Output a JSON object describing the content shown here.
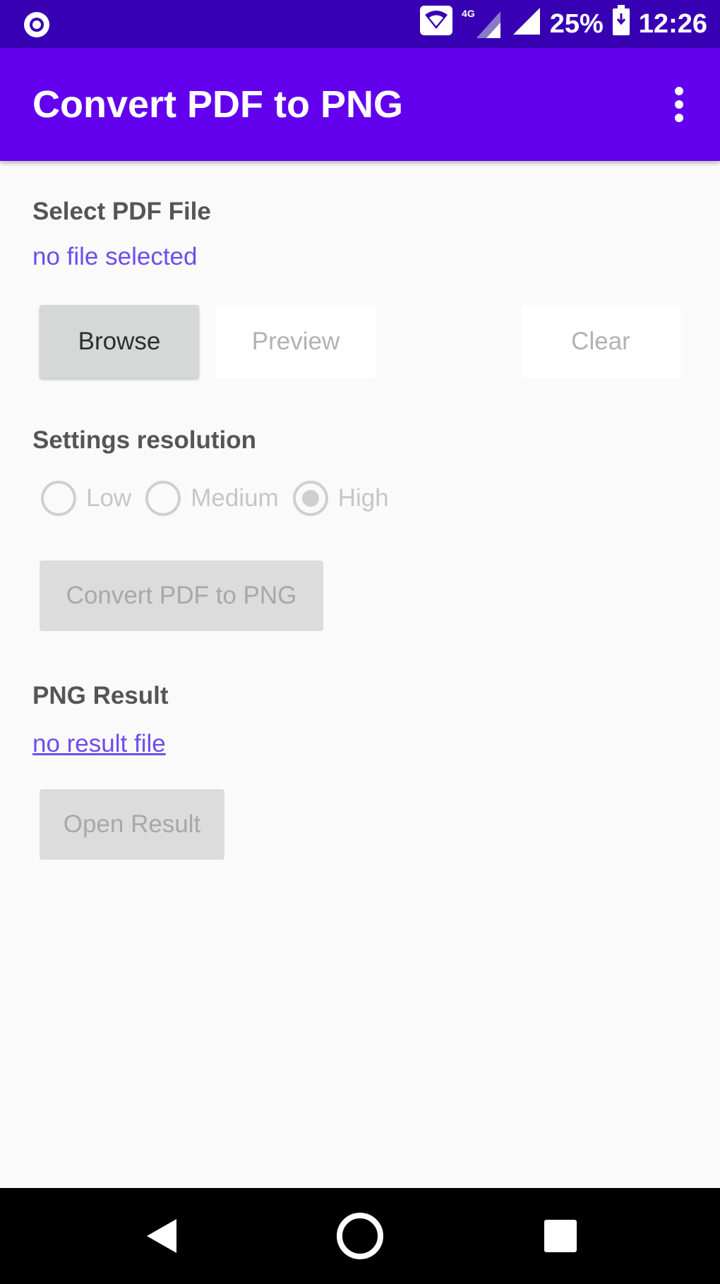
{
  "status_bar": {
    "battery": "25%",
    "time": "12:26",
    "network": "4G"
  },
  "app_bar": {
    "title": "Convert PDF to PNG",
    "menu_icon": "more-vert-icon"
  },
  "select_section": {
    "label": "Select PDF File",
    "file_status": "no file selected",
    "buttons": {
      "browse": "Browse",
      "preview": "Preview",
      "clear": "Clear"
    }
  },
  "settings_section": {
    "label": "Settings resolution",
    "options": [
      {
        "label": "Low",
        "selected": false
      },
      {
        "label": "Medium",
        "selected": false
      },
      {
        "label": "High",
        "selected": true
      }
    ],
    "convert_button": "Convert PDF to PNG"
  },
  "result_section": {
    "label": "PNG Result",
    "result_status": "no result file",
    "open_button": "Open Result"
  },
  "nav_bar": {
    "back_icon": "back-icon",
    "home_icon": "home-icon",
    "recents_icon": "recents-icon"
  },
  "colors": {
    "status_bar": "#3700b3",
    "app_bar": "#6200ee",
    "link": "#6d4df0"
  }
}
